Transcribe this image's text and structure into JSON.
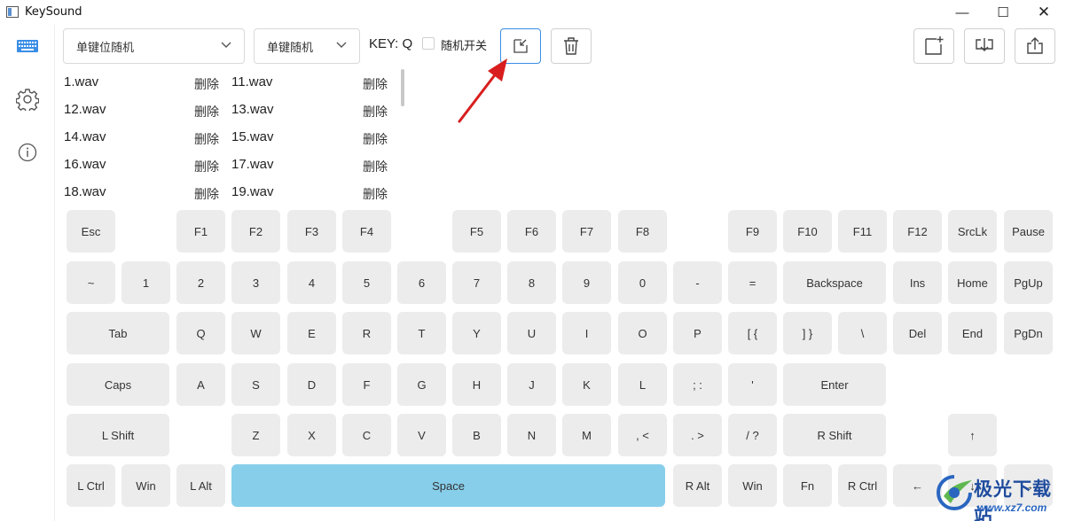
{
  "window": {
    "title": "KeySound",
    "minimize_glyph": "—",
    "maximize_glyph": "☐",
    "close_glyph": "✕"
  },
  "sidebar": {
    "items": [
      {
        "icon": "keyboard-icon",
        "active": true
      },
      {
        "icon": "gear-icon",
        "active": false
      },
      {
        "icon": "info-icon",
        "active": false
      }
    ],
    "accent": "#3a8ee6"
  },
  "toolbar": {
    "mode_select": {
      "value": "单键位随机"
    },
    "random_select": {
      "value": "单键随机"
    },
    "key_label": "KEY: Q",
    "random_toggle_label": "随机开关",
    "random_toggle_checked": false
  },
  "files": {
    "delete_label": "删除",
    "rows": [
      [
        {
          "name": "1.wav"
        },
        {
          "name": "11.wav"
        }
      ],
      [
        {
          "name": "12.wav"
        },
        {
          "name": "13.wav"
        }
      ],
      [
        {
          "name": "14.wav"
        },
        {
          "name": "15.wav"
        }
      ],
      [
        {
          "name": "16.wav"
        },
        {
          "name": "17.wav"
        }
      ],
      [
        {
          "name": "18.wav"
        },
        {
          "name": "19.wav"
        }
      ]
    ]
  },
  "keyboard": {
    "rows": [
      [
        "Esc",
        "F1",
        "F2",
        "F3",
        "F4",
        "F5",
        "F6",
        "F7",
        "F8",
        "F9",
        "F10",
        "F11",
        "F12",
        "SrcLk",
        "Pause"
      ],
      [
        "~",
        "1",
        "2",
        "3",
        "4",
        "5",
        "6",
        "7",
        "8",
        "9",
        "0",
        "-",
        "=",
        "Backspace",
        "Ins",
        "Home",
        "PgUp"
      ],
      [
        "Tab",
        "Q",
        "W",
        "E",
        "R",
        "T",
        "Y",
        "U",
        "I",
        "O",
        "P",
        "[ {",
        "] }",
        "\\",
        "Del",
        "End",
        "PgDn"
      ],
      [
        "Caps",
        "A",
        "S",
        "D",
        "F",
        "G",
        "H",
        "J",
        "K",
        "L",
        "; :",
        "'",
        "Enter"
      ],
      [
        "L Shift",
        "Z",
        "X",
        "C",
        "V",
        "B",
        "N",
        "M",
        ", <",
        ". >",
        "/ ?",
        "R Shift",
        "↑"
      ],
      [
        "L Ctrl",
        "Win",
        "L Alt",
        "Space",
        "R Alt",
        "Win",
        "Fn",
        "R Ctrl",
        "←",
        "↓",
        "→"
      ]
    ],
    "space_color": "#87ceeb",
    "key_color": "#ececec"
  },
  "watermark": {
    "text": "极光下载站",
    "url": "www.xz7.com"
  }
}
